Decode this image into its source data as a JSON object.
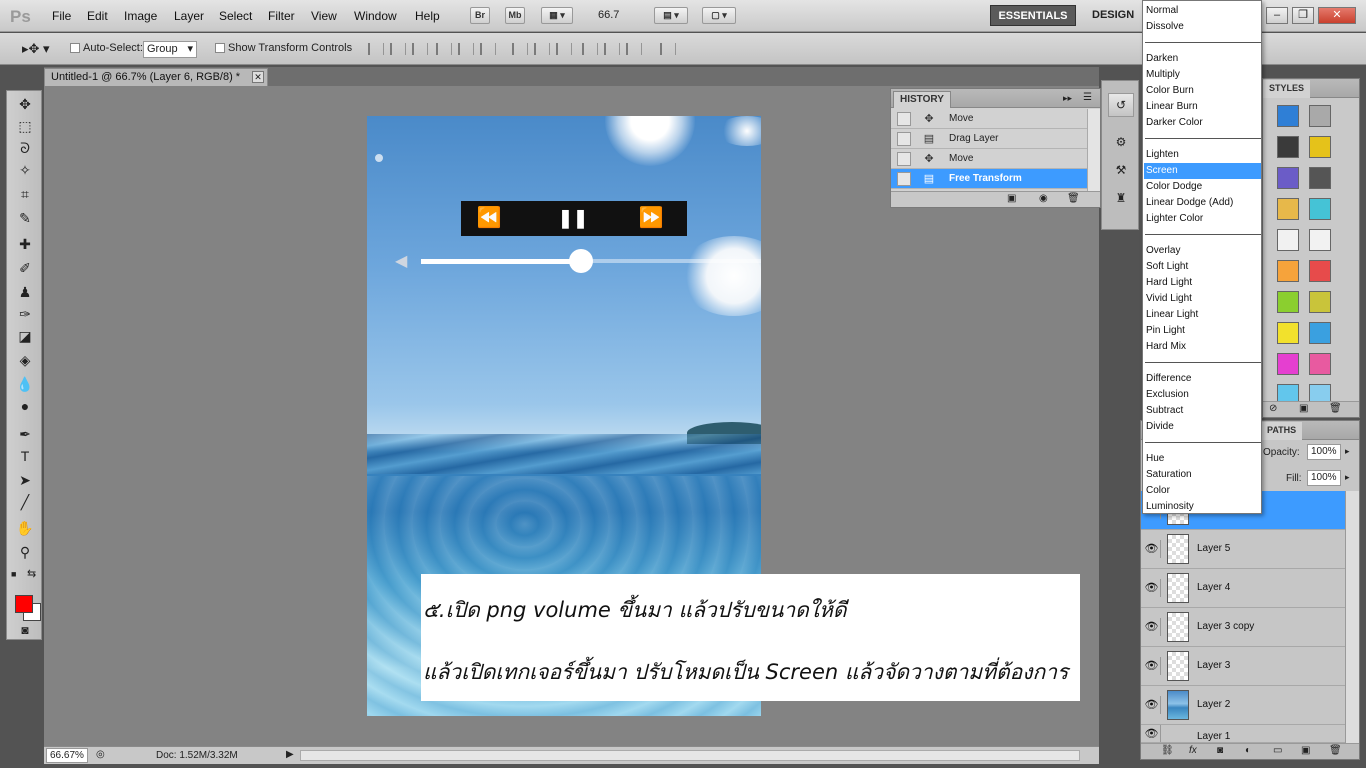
{
  "app": {
    "logo": "Ps",
    "menus": [
      "File",
      "Edit",
      "Image",
      "Layer",
      "Select",
      "Filter",
      "View",
      "Window",
      "Help"
    ],
    "bridge_btn": "Br",
    "minibridge_btn": "Mb",
    "zoom_level": "66.7",
    "workspace_active": "ESSENTIALS",
    "workspace_other": "DESIGN"
  },
  "options_bar": {
    "auto_select_label": "Auto-Select:",
    "auto_select_value": "Group",
    "show_transform_label": "Show Transform Controls"
  },
  "document": {
    "tab_title": "Untitled-1 @ 66.7% (Layer 6, RGB/8) *",
    "zoom_status": "66.67%",
    "doc_info": "Doc: 1.52M/3.32M"
  },
  "player": {
    "rewind_icon": "⏪",
    "pause_icon": "❚❚",
    "forward_icon": "⏩",
    "volume_level": 0.47
  },
  "annotation": {
    "line1": "๕.เปิด png volume ขึ้นมา แล้วปรับขนาดให้ดี",
    "line2": "แล้วเปิดเทกเจอร์ขึ้นมา ปรับโหมดเป็น Screen แล้วจัดวางตามที่ต้องการ"
  },
  "history": {
    "tab": "HISTORY",
    "items": [
      {
        "label": "Move",
        "icon": "move-icon"
      },
      {
        "label": "Drag Layer",
        "icon": "document-icon"
      },
      {
        "label": "Move",
        "icon": "move-icon"
      },
      {
        "label": "Free Transform",
        "icon": "document-icon",
        "selected": true
      }
    ]
  },
  "styles_panel": {
    "tab": "STYLES",
    "swatch_colors": [
      "#2f7fd6",
      "#a9a9a9",
      "#3a3a3a",
      "#e5c21a",
      "#6b5cc7",
      "#555555",
      "#e7b84a",
      "#45c3d6",
      "#f1f1f1",
      "#f2f2f2",
      "#f6a33b",
      "#e74b4b",
      "#8bcf2f",
      "#c9c43a",
      "#f2e12c",
      "#3aa0e0",
      "#e53fd0",
      "#e85aa0",
      "#62c6ec",
      "#88cdee"
    ]
  },
  "layers_panel": {
    "tab": "PATHS",
    "opacity_label": "Opacity:",
    "opacity_value": "100%",
    "fill_label": "Fill:",
    "fill_value": "100%",
    "layers": [
      {
        "name": "",
        "selected": true
      },
      {
        "name": "Layer 5"
      },
      {
        "name": "Layer 4"
      },
      {
        "name": "Layer 3 copy"
      },
      {
        "name": "Layer 3"
      },
      {
        "name": "Layer 2",
        "photo": true
      },
      {
        "name": "Layer 1"
      }
    ]
  },
  "blend_modes": {
    "selected": "Screen",
    "groups": [
      [
        "Normal",
        "Dissolve"
      ],
      [
        "Darken",
        "Multiply",
        "Color Burn",
        "Linear Burn",
        "Darker Color"
      ],
      [
        "Lighten",
        "Screen",
        "Color Dodge",
        "Linear Dodge (Add)",
        "Lighter Color"
      ],
      [
        "Overlay",
        "Soft Light",
        "Hard Light",
        "Vivid Light",
        "Linear Light",
        "Pin Light",
        "Hard Mix"
      ],
      [
        "Difference",
        "Exclusion",
        "Subtract",
        "Divide"
      ],
      [
        "Hue",
        "Saturation",
        "Color",
        "Luminosity"
      ]
    ]
  },
  "colors": {
    "foreground": "#ff0000",
    "background": "#ffffff",
    "selection": "#3d9bff"
  }
}
